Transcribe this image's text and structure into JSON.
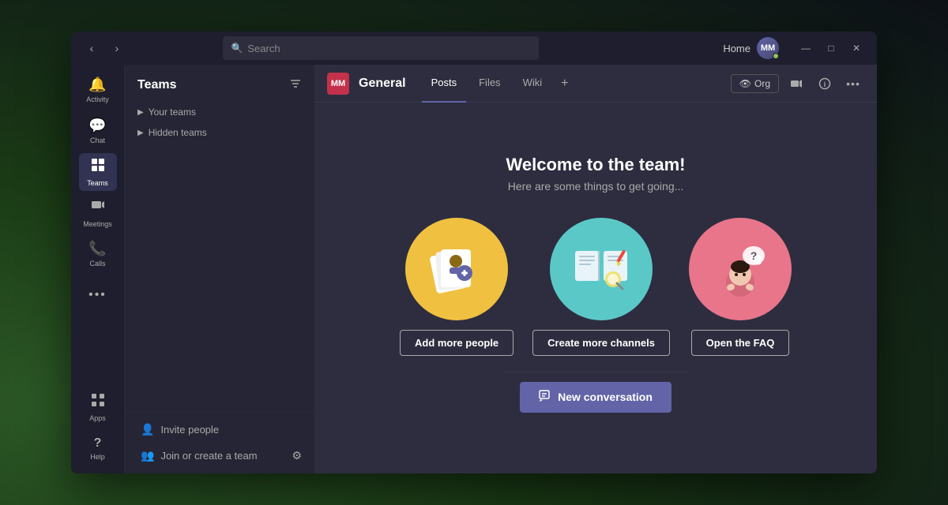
{
  "titlebar": {
    "search_placeholder": "Search",
    "home_label": "Home",
    "back_icon": "‹",
    "forward_icon": "›",
    "minimize_icon": "—",
    "maximize_icon": "□",
    "close_icon": "✕",
    "avatar_initials": "MM"
  },
  "sidebar": {
    "items": [
      {
        "id": "activity",
        "label": "Activity",
        "icon": "🔔"
      },
      {
        "id": "chat",
        "label": "Chat",
        "icon": "💬"
      },
      {
        "id": "teams",
        "label": "Teams",
        "icon": "⊞"
      },
      {
        "id": "meetings",
        "label": "Meetings",
        "icon": "⊞"
      },
      {
        "id": "calls",
        "label": "Calls",
        "icon": "📞"
      },
      {
        "id": "more",
        "label": "...",
        "icon": "···"
      }
    ],
    "bottom_items": [
      {
        "id": "apps",
        "label": "Apps",
        "icon": "⊞"
      },
      {
        "id": "help",
        "label": "Help",
        "icon": "?"
      }
    ]
  },
  "teams_panel": {
    "title": "Teams",
    "filter_icon": "⊟",
    "groups": [
      {
        "id": "your-teams",
        "label": "Your teams",
        "expanded": false
      },
      {
        "id": "hidden-teams",
        "label": "Hidden teams",
        "expanded": false
      }
    ],
    "footer": {
      "invite_label": "Invite people",
      "join_label": "Join or create a team",
      "settings_icon": "⚙"
    }
  },
  "channel": {
    "icon_text": "MM",
    "name": "General",
    "tabs": [
      {
        "id": "posts",
        "label": "Posts",
        "active": true
      },
      {
        "id": "files",
        "label": "Files",
        "active": false
      },
      {
        "id": "wiki",
        "label": "Wiki",
        "active": false
      }
    ],
    "add_tab_icon": "+",
    "actions": {
      "org_label": "Org",
      "video_icon": "📹",
      "info_icon": "ℹ",
      "more_icon": "···"
    }
  },
  "welcome": {
    "title": "Welcome to the team!",
    "subtitle": "Here are some things to get going...",
    "cards": [
      {
        "id": "add-people",
        "btn_label": "Add more people",
        "color": "yellow"
      },
      {
        "id": "create-channels",
        "btn_label": "Create more channels",
        "color": "teal"
      },
      {
        "id": "open-faq",
        "btn_label": "Open the FAQ",
        "color": "pink"
      }
    ],
    "new_conv_btn": "New conversation",
    "new_conv_icon": "✏"
  }
}
